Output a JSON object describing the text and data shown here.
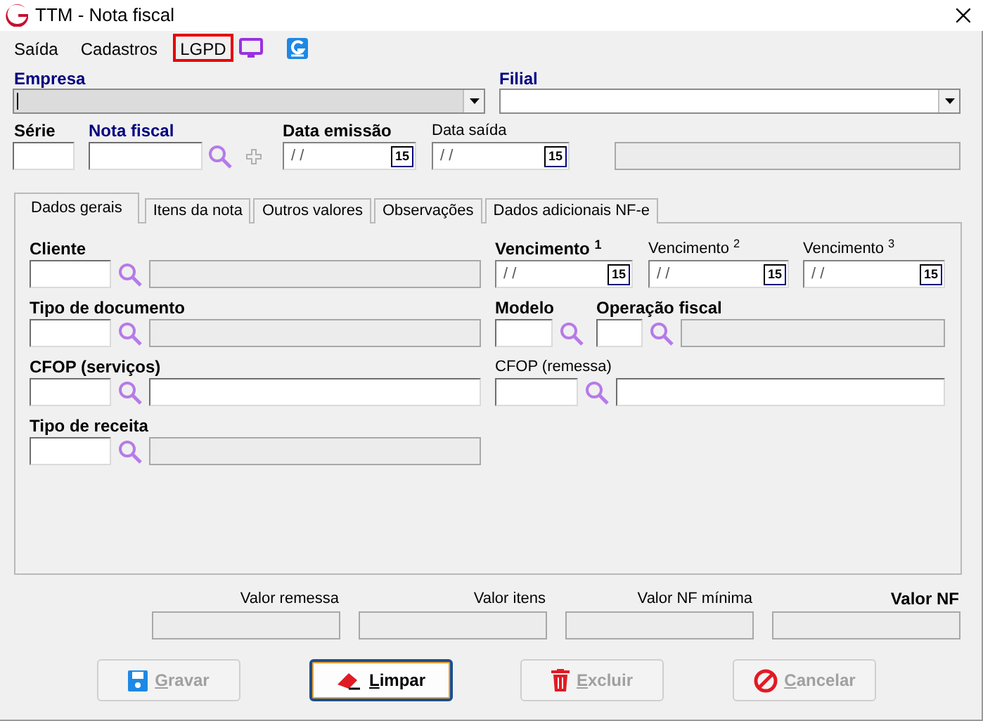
{
  "window": {
    "title": "TTM - Nota fiscal"
  },
  "menu": [
    {
      "label": "Saída",
      "highlighted": false
    },
    {
      "label": "Cadastros",
      "highlighted": false
    },
    {
      "label": "LGPD",
      "highlighted": true
    }
  ],
  "header": {
    "empresa": {
      "label": "Empresa",
      "kind": "required",
      "disabled": true
    },
    "filial": {
      "label": "Filial",
      "kind": "required",
      "disabled": false
    },
    "serie": {
      "label": "Série",
      "kind": "bold"
    },
    "nota_fiscal": {
      "label": "Nota fiscal",
      "kind": "required"
    },
    "data_emissao": {
      "label": "Data emissão",
      "kind": "bold",
      "value": "/ /",
      "calendar_label": "15"
    },
    "data_saida": {
      "label": "Data saída",
      "kind": "plain",
      "value": "/ /",
      "calendar_label": "15"
    },
    "info_field": {
      "disabled": true
    }
  },
  "tabs": [
    {
      "label": "Dados gerais",
      "selected": true
    },
    {
      "label": "Itens da nota",
      "selected": false
    },
    {
      "label": "Outros valores",
      "selected": false
    },
    {
      "label": "Observações",
      "selected": false
    },
    {
      "label": "Dados adicionais NF-e",
      "selected": false
    }
  ],
  "tab_panel": {
    "left": [
      {
        "label": "Cliente",
        "kind": "bold",
        "description_disabled": true
      },
      {
        "label": "Tipo de documento",
        "kind": "bold",
        "description_disabled": true
      },
      {
        "label": "CFOP (serviços)",
        "kind": "bold",
        "description_disabled": false
      },
      {
        "label": "Tipo de receita",
        "kind": "bold",
        "description_disabled": true
      }
    ],
    "vencimentos": [
      {
        "label": "Vencimento $^{1}$",
        "kind": "bold",
        "value": "/ /",
        "calendar_label": "15"
      },
      {
        "label": "Vencimento $^{2}$",
        "kind": "plain",
        "value": "/ /",
        "calendar_label": "15"
      },
      {
        "label": "Vencimento $^{3}$",
        "kind": "plain",
        "value": "/ /",
        "calendar_label": "15"
      }
    ],
    "modelo": {
      "label": "Modelo",
      "kind": "bold"
    },
    "operacao_fiscal": {
      "label": "Operação fiscal",
      "kind": "bold",
      "description_disabled": true
    },
    "cfop_remessa": {
      "label": "CFOP (remessa)",
      "kind": "plain",
      "description_disabled": false
    }
  },
  "totals": [
    {
      "label": "Valor remessa",
      "kind": "plain",
      "disabled": true
    },
    {
      "label": "Valor itens",
      "kind": "plain",
      "disabled": true
    },
    {
      "label": "Valor NF mínima",
      "kind": "plain",
      "disabled": true
    },
    {
      "label": "Valor NF",
      "kind": "bold",
      "disabled": true
    }
  ],
  "buttons": [
    {
      "label": "Gravar",
      "kind": "save",
      "disabled": true,
      "focused": false
    },
    {
      "label": "Limpar",
      "kind": "eraser",
      "disabled": false,
      "focused": true
    },
    {
      "label": "Excluir",
      "kind": "trash",
      "disabled": true,
      "focused": false
    },
    {
      "label": "Cancelar",
      "kind": "cancel",
      "disabled": true,
      "focused": false
    }
  ]
}
